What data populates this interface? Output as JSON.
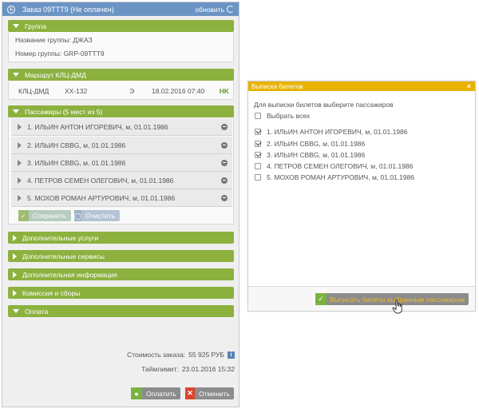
{
  "order": {
    "title": "Заказ 09TTT9 (Не оплачен)",
    "refresh_label": "обновить"
  },
  "group": {
    "section_title": "Группа",
    "name_label": "Название группы:",
    "name_value": "ДЖАЗ",
    "number_label": "Номер группы:",
    "number_value": "GRP-09TTT9"
  },
  "route": {
    "section_title": "Маршрут КЛЦ-ДМД",
    "segment": "КЛЦ-ДМД",
    "flight": "XX-132",
    "class": "Э",
    "datetime": "18.02.2016 07:40",
    "status": "HK"
  },
  "passengers": {
    "section_title": "Пассажиры (5 мест из 5)",
    "items": [
      "1. ИЛЬИН АНТОН ИГОРЕВИЧ, м, 01.01.1986",
      "2. ИЛЬИН СВВG, м, 01.01.1986",
      "3. ИЛЬИН СВВG, м, 01.01.1986",
      "4. ПЕТРОВ СЕМЕН ОЛЕГОВИЧ, м, 01.01.1986",
      "5. МОХОВ РОМАН АРТУРОВИЧ, м, 01.01.1986"
    ],
    "save_label": "Сохранить",
    "clear_label": "Очистить"
  },
  "sections": {
    "extra_services": "Дополнительные услуги",
    "extra_services2": "Дополнительные сервисы",
    "extra_info": "Дополнительная информация",
    "commission": "Комиссия и сборы",
    "payment": "Оплата"
  },
  "totals": {
    "cost_label": "Стоимость заказа:",
    "cost_value": "55 925 РУБ",
    "timelimit_label": "Таймлимит:",
    "timelimit_value": "23.01.2016 15:32"
  },
  "footer": {
    "pay_label": "Оплатить",
    "cancel_label": "Отменить"
  },
  "dialog": {
    "title": "Выписка билетов",
    "close": "×",
    "instruction": "Для выписки билетов выберите пассажиров",
    "select_all": "Выбрать всех",
    "passengers": [
      {
        "label": "1. ИЛЬИН АНТОН ИГОРЕВИЧ, м, 01.01.1986",
        "checked": true
      },
      {
        "label": "2. ИЛЬИН СВВG, м, 01.01.1986",
        "checked": true
      },
      {
        "label": "3. ИЛЬИН СВВG, м, 01.01.1986",
        "checked": true
      },
      {
        "label": "4. ПЕТРОВ СЕМЕН ОЛЕГОВИЧ, м, 01.01.1986",
        "checked": false
      },
      {
        "label": "5. МОХОВ РОМАН АРТУРОВИЧ, м, 01.01.1986",
        "checked": false
      }
    ],
    "issue_label": "Выписать билеты выбранным пассажирам"
  },
  "colors": {
    "header_blue": "#6b94c4",
    "section_green": "#8cb13f",
    "dialog_yellow": "#e8b200",
    "ok_green": "#7ab23f",
    "cancel_red": "#d9452e"
  }
}
